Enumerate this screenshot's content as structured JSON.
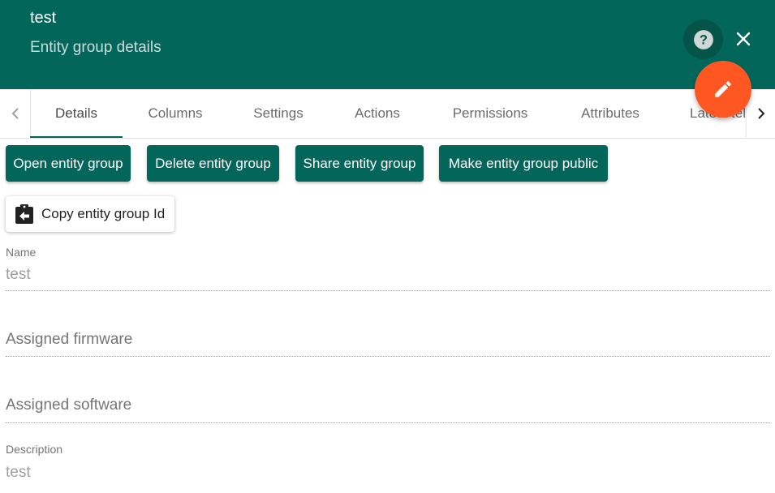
{
  "header": {
    "title": "test",
    "subtitle": "Entity group details",
    "help_icon": "help-circle-icon",
    "close_icon": "close-icon",
    "edit_icon": "pencil-icon"
  },
  "tabs": [
    {
      "label": "Details",
      "active": true
    },
    {
      "label": "Columns"
    },
    {
      "label": "Settings"
    },
    {
      "label": "Actions"
    },
    {
      "label": "Permissions"
    },
    {
      "label": "Attributes"
    },
    {
      "label": "Latest tel"
    }
  ],
  "actions": {
    "open": "Open entity group",
    "delete": "Delete entity group",
    "share": "Share entity group",
    "make_public": "Make entity group public",
    "copy_id": "Copy entity group Id"
  },
  "form": {
    "name_label": "Name",
    "name_value": "test",
    "firmware_placeholder": "Assigned firmware",
    "software_placeholder": "Assigned software",
    "description_label": "Description",
    "description_value": "test"
  },
  "colors": {
    "primary": "#03665a",
    "accent": "#ff5722"
  }
}
